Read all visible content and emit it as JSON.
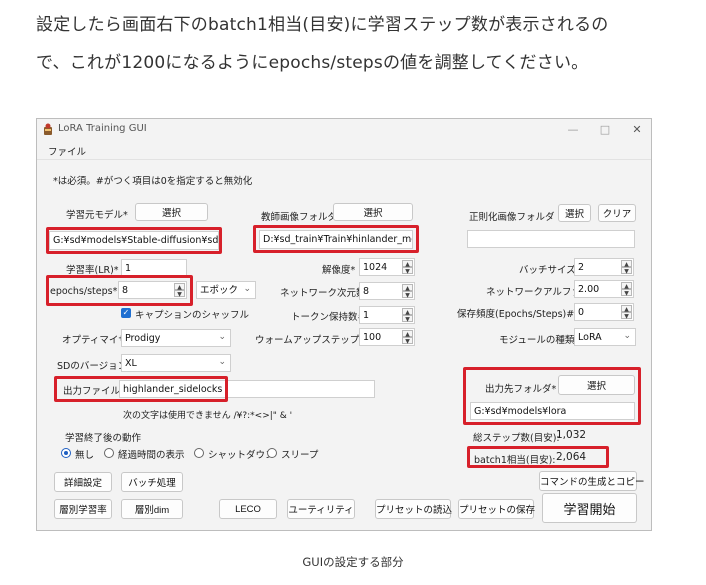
{
  "intro": {
    "line1": "設定したら画面右下のbatch1相当(目安)に学習ステップ数が表示されるの",
    "line2": "で、これが1200になるようにepochs/stepsの値を調整してください。"
  },
  "window": {
    "title": "LoRA Training GUI",
    "minimize": "—",
    "maximize": "□",
    "close": "✕",
    "menu_file": "ファイル"
  },
  "form": {
    "note": "*は必須。#がつく項目は0を指定すると無効化",
    "base_model_label": "学習元モデル*",
    "base_model_button": "選択",
    "base_model_path": "G:¥sd¥models¥Stable-diffusion¥sdxl¥animagine",
    "teacher_label": "教師画像フォルダ*",
    "teacher_button": "選択",
    "teacher_path": "D:¥sd_train¥Train¥hinlander_mob¥train",
    "reg_label": "正則化画像フォルダ",
    "reg_button": "選択",
    "reg_clear": "クリア",
    "reg_path": "",
    "lr_label": "学習率(LR)*",
    "lr_value": "1",
    "resolution_label": "解像度*",
    "resolution_value": "1024",
    "batch_label": "バッチサイズ*",
    "batch_value": "2",
    "epochs_label": "epochs/steps*",
    "epochs_value": "8",
    "epochs_unit": "エポック",
    "net_dim_label": "ネットワーク次元数*",
    "net_dim_value": "8",
    "net_alpha_label": "ネットワークアルファ*",
    "net_alpha_value": "2.00",
    "shuffle_label": "キャプションのシャッフル",
    "token_label": "トークン保持数#",
    "token_value": "1",
    "save_freq_label": "保存頻度(Epochs/Steps)#",
    "save_freq_value": "0",
    "optimizer_label": "オプティマイザ*",
    "optimizer_value": "Prodigy",
    "warmup_label": "ウォームアップステップ数#",
    "warmup_value": "100",
    "module_label": "モジュールの種類*",
    "module_value": "LoRA",
    "sd_version_label": "SDのバージョン",
    "sd_version_value": "XL",
    "output_name_label": "出力ファイル名",
    "output_name_value": "highlander_sidelocks",
    "invalid_chars": "次の文字は使用できません /¥?:*<>|\" & '",
    "output_folder_label": "出力先フォルダ*",
    "output_folder_button": "選択",
    "output_folder_path": "G:¥sd¥models¥lora",
    "after_label": "学習終了後の動作",
    "after_options": [
      "無し",
      "経過時間の表示",
      "シャットダウン",
      "スリープ"
    ],
    "total_steps_label": "総ステップ数(目安):",
    "total_steps_value": "1,032",
    "batch1_label": "batch1相当(目安):",
    "batch1_value": "2,064"
  },
  "buttons": {
    "advanced": "詳細設定",
    "batch": "バッチ処理",
    "cmd": "コマンドの生成とコピー",
    "layer_lr": "層別学習率",
    "layer_dim": "層別dim",
    "leco": "LECO",
    "utility": "ユーティリティ",
    "preset_load": "プリセットの読込",
    "preset_save": "プリセットの保存",
    "start": "学習開始"
  },
  "caption": "GUIの設定する部分",
  "colors": {
    "highlight": "#d7202a",
    "accent": "#1f6fd1"
  }
}
